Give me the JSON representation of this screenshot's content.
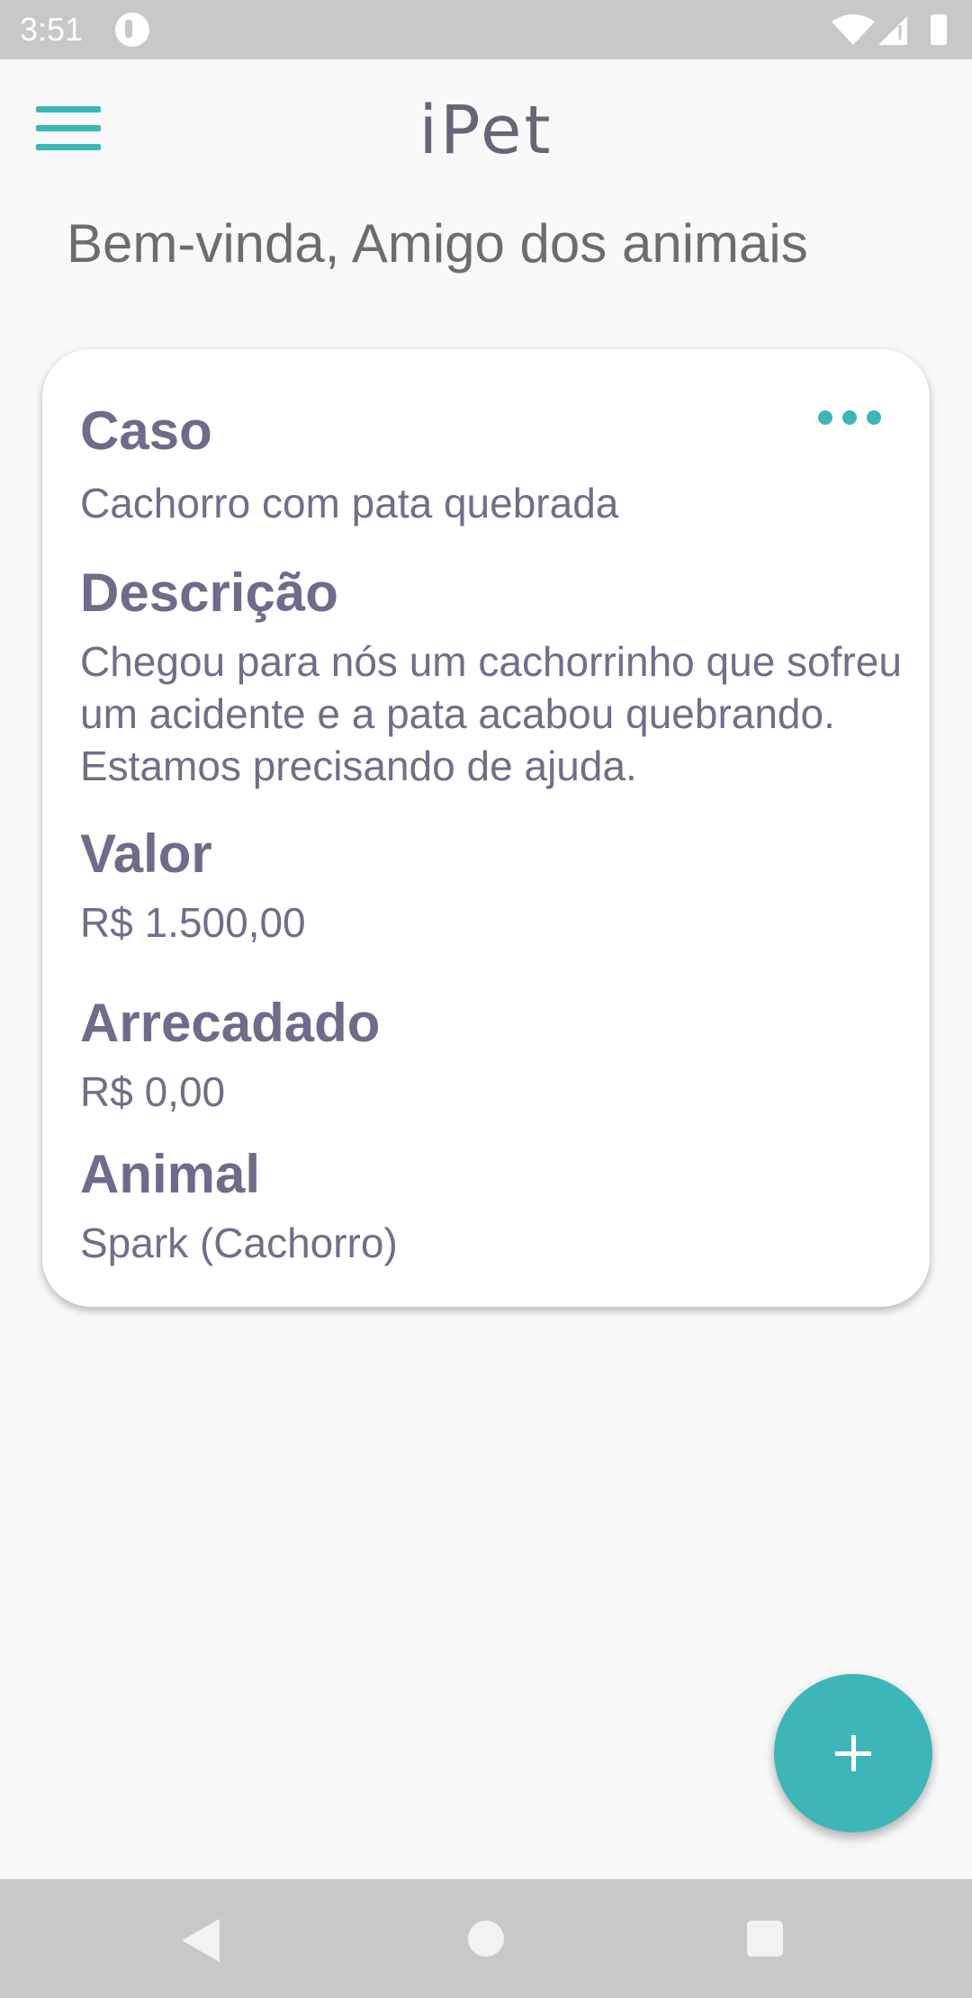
{
  "status_bar": {
    "time": "3:51"
  },
  "app_bar": {
    "title": "iPet",
    "menu_icon": "hamburger-menu-icon"
  },
  "welcome": "Bem-vinda, Amigo dos animais",
  "card": {
    "case_label": "Caso",
    "case_value": "Cachorro com pata quebrada",
    "description_label": "Descrição",
    "description_value": "Chegou para nós um cachorrinho que sofreu um acidente e a pata acabou quebrando. Estamos precisando de ajuda.",
    "value_label": "Valor",
    "value_value": "R$ 1.500,00",
    "collected_label": "Arrecadado",
    "collected_value": "R$ 0,00",
    "animal_label": "Animal",
    "animal_value": "Spark (Cachorro)",
    "more_icon": "more-horizontal-icon"
  },
  "fab": {
    "icon": "plus-icon"
  },
  "colors": {
    "accent": "#3cb6b8",
    "text_primary": "#6e6b8b",
    "background": "#f9f9f9"
  }
}
